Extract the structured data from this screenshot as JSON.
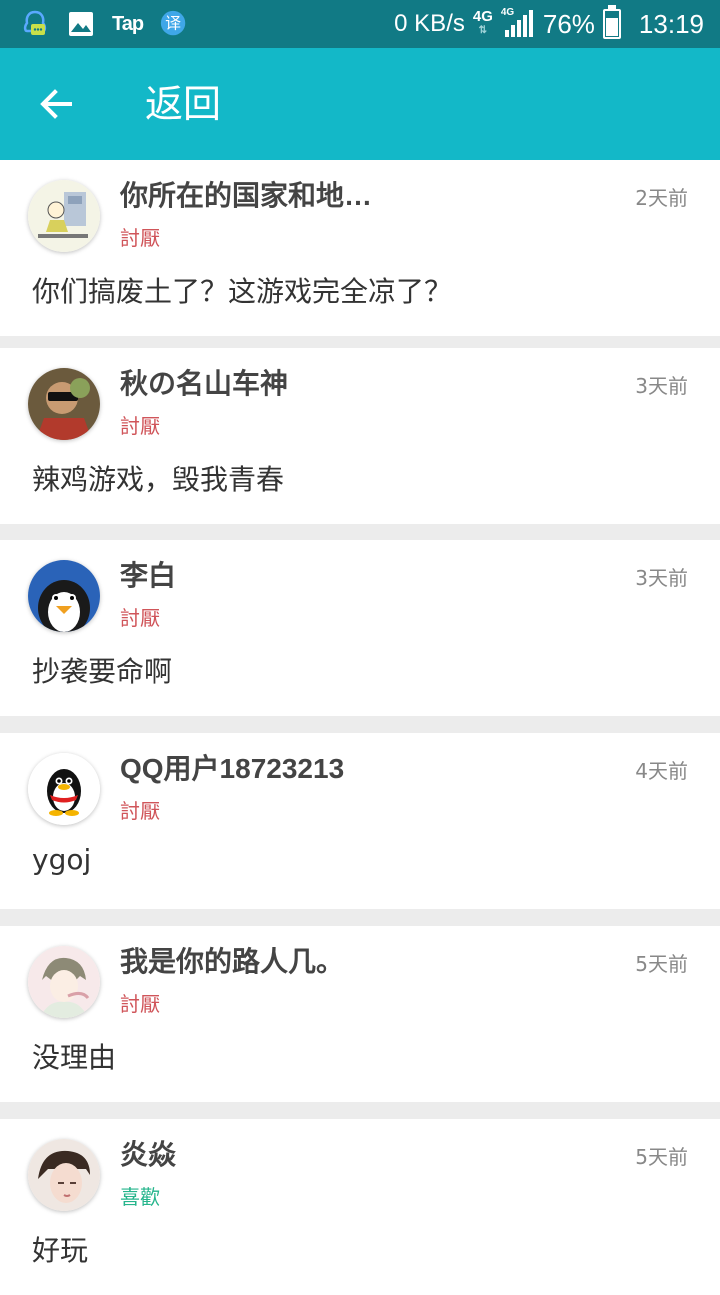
{
  "status_bar": {
    "icons": [
      "qq-chat-icon",
      "image-icon",
      "tap-logo",
      "translate-icon"
    ],
    "tap_label": "Tap",
    "translate_label": "译",
    "net_speed": "0 KB/s",
    "network_type": "4G",
    "network_type_small": "4G",
    "battery": "76%",
    "battery_level": 0.76,
    "time": "13:19"
  },
  "app_bar": {
    "back_icon": "arrow-left-icon",
    "title": "返回"
  },
  "colors": {
    "app_bar": "#13b8c8",
    "status_bar": "#117a85",
    "dislike_tag": "#d0555a",
    "like_tag": "#26b58c"
  },
  "comments": [
    {
      "user": "你所在的国家和地…",
      "tag": "討厭",
      "tag_type": "dislike",
      "time": "2天前",
      "text": "你们搞废土了？这游戏完全凉了？"
    },
    {
      "user": "秋の名山车神",
      "tag": "討厭",
      "tag_type": "dislike",
      "time": "3天前",
      "text": "辣鸡游戏，毁我青春"
    },
    {
      "user": "李白",
      "tag": "討厭",
      "tag_type": "dislike",
      "time": "3天前",
      "text": "抄袭要命啊"
    },
    {
      "user": "QQ用户18723213",
      "tag": "討厭",
      "tag_type": "dislike",
      "time": "4天前",
      "text": "ygoj"
    },
    {
      "user": "我是你的路人几。",
      "tag": "討厭",
      "tag_type": "dislike",
      "time": "5天前",
      "text": "没理由"
    },
    {
      "user": "炎焱",
      "tag": "喜歡",
      "tag_type": "like",
      "time": "5天前",
      "text": "好玩"
    }
  ]
}
